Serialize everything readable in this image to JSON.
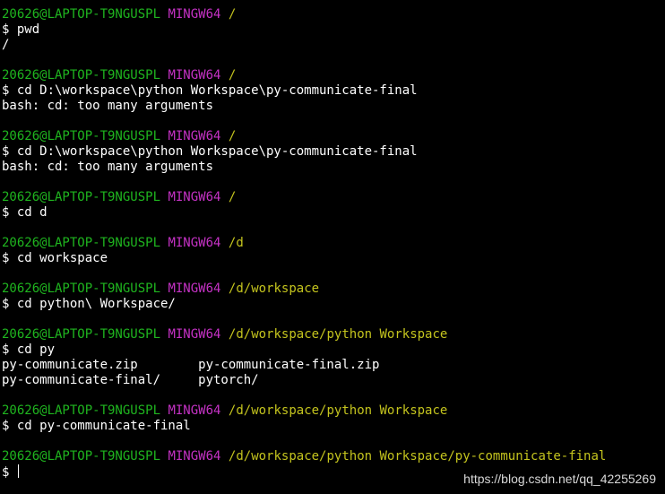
{
  "colors": {
    "background": "#000000",
    "text": "#ffffff",
    "user_host": "#1fb51f",
    "system": "#c532c5",
    "path": "#c4c41e"
  },
  "terminal": {
    "lines": [
      {
        "type": "prompt",
        "user": "20626@LAPTOP-T9NGUSPL",
        "system": "MINGW64",
        "path": "/"
      },
      {
        "type": "cmd",
        "text": "$ pwd"
      },
      {
        "type": "out",
        "text": "/"
      },
      {
        "type": "blank"
      },
      {
        "type": "prompt",
        "user": "20626@LAPTOP-T9NGUSPL",
        "system": "MINGW64",
        "path": "/"
      },
      {
        "type": "cmd",
        "text": "$ cd D:\\workspace\\python Workspace\\py-communicate-final"
      },
      {
        "type": "out",
        "text": "bash: cd: too many arguments"
      },
      {
        "type": "blank"
      },
      {
        "type": "prompt",
        "user": "20626@LAPTOP-T9NGUSPL",
        "system": "MINGW64",
        "path": "/"
      },
      {
        "type": "cmd",
        "text": "$ cd D:\\workspace\\python Workspace\\py-communicate-final"
      },
      {
        "type": "out",
        "text": "bash: cd: too many arguments"
      },
      {
        "type": "blank"
      },
      {
        "type": "prompt",
        "user": "20626@LAPTOP-T9NGUSPL",
        "system": "MINGW64",
        "path": "/"
      },
      {
        "type": "cmd",
        "text": "$ cd d"
      },
      {
        "type": "blank"
      },
      {
        "type": "prompt",
        "user": "20626@LAPTOP-T9NGUSPL",
        "system": "MINGW64",
        "path": "/d"
      },
      {
        "type": "cmd",
        "text": "$ cd workspace"
      },
      {
        "type": "blank"
      },
      {
        "type": "prompt",
        "user": "20626@LAPTOP-T9NGUSPL",
        "system": "MINGW64",
        "path": "/d/workspace"
      },
      {
        "type": "cmd",
        "text": "$ cd python\\ Workspace/"
      },
      {
        "type": "blank"
      },
      {
        "type": "prompt",
        "user": "20626@LAPTOP-T9NGUSPL",
        "system": "MINGW64",
        "path": "/d/workspace/python Workspace"
      },
      {
        "type": "cmd",
        "text": "$ cd py"
      },
      {
        "type": "out",
        "text": "py-communicate.zip        py-communicate-final.zip"
      },
      {
        "type": "out",
        "text": "py-communicate-final/     pytorch/"
      },
      {
        "type": "blank"
      },
      {
        "type": "prompt",
        "user": "20626@LAPTOP-T9NGUSPL",
        "system": "MINGW64",
        "path": "/d/workspace/python Workspace"
      },
      {
        "type": "cmd",
        "text": "$ cd py-communicate-final"
      },
      {
        "type": "blank"
      },
      {
        "type": "prompt",
        "user": "20626@LAPTOP-T9NGUSPL",
        "system": "MINGW64",
        "path": "/d/workspace/python Workspace/py-communicate-final"
      },
      {
        "type": "input",
        "text": "$ "
      }
    ]
  },
  "watermark": "https://blog.csdn.net/qq_42255269"
}
